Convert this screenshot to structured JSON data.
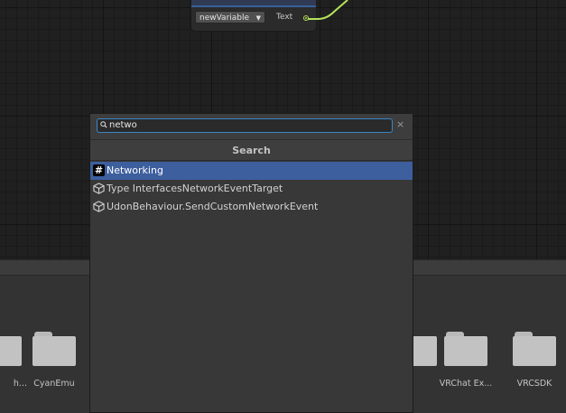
{
  "graph": {
    "node": {
      "variable_dropdown": "newVariable",
      "port_label": "Text"
    }
  },
  "search_popup": {
    "query": "netwo",
    "clear_glyph": "×",
    "section_title": "Search",
    "results": [
      {
        "label": "Networking",
        "icon": "hash-icon",
        "selected": true
      },
      {
        "label": "Type InterfacesNetworkEventTarget",
        "icon": "cube-icon",
        "selected": false
      },
      {
        "label": "UdonBehaviour.SendCustomNetworkEvent",
        "icon": "cube-icon",
        "selected": false
      }
    ]
  },
  "project_panel": {
    "folders": [
      {
        "label": "h..."
      },
      {
        "label": "CyanEmu"
      },
      {
        "label": ""
      },
      {
        "label": "VRChat Ex..."
      },
      {
        "label": "VRCSDK"
      }
    ]
  },
  "colors": {
    "selection": "#3d5f9e",
    "search_focus": "#3b86c6",
    "wire": "#b6e35a"
  }
}
